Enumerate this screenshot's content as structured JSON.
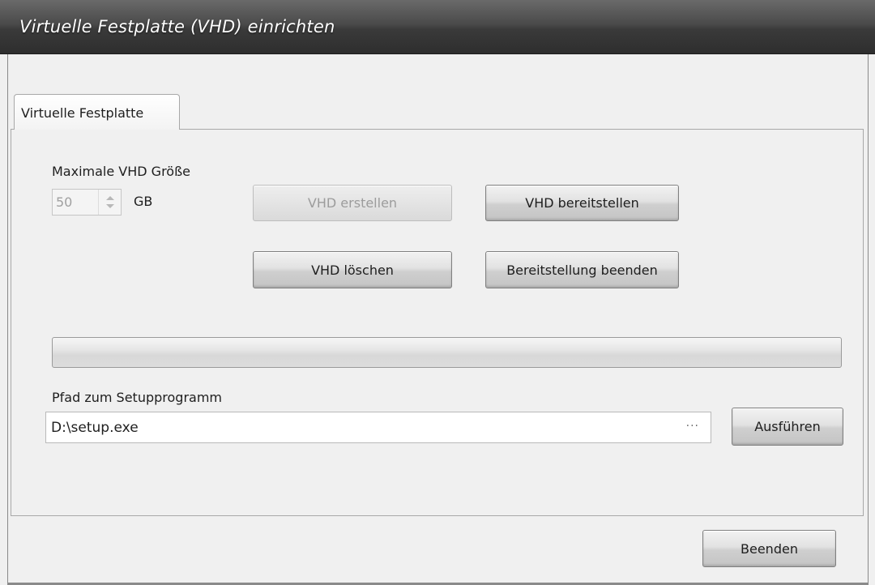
{
  "window": {
    "title": "Virtuelle Festplatte (VHD) einrichten"
  },
  "tabs": [
    {
      "label": "Virtuelle Festplatte",
      "selected": true
    }
  ],
  "vhd_size": {
    "label": "Maximale VHD Größe",
    "value": "50",
    "unit": "GB",
    "enabled": false
  },
  "buttons": {
    "create": {
      "label": "VHD erstellen",
      "enabled": false
    },
    "mount": {
      "label": "VHD bereitstellen",
      "enabled": true
    },
    "delete": {
      "label": "VHD löschen",
      "enabled": true
    },
    "unmount": {
      "label": "Bereitstellung beenden",
      "enabled": true
    },
    "run": {
      "label": "Ausführen",
      "enabled": true
    },
    "exit": {
      "label": "Beenden",
      "enabled": true
    }
  },
  "progress": {
    "value_percent": 0
  },
  "setup_path": {
    "label": "Pfad zum Setupprogramm",
    "value": "D:\\setup.exe",
    "browse_glyph": "..."
  },
  "icons": {
    "spin_up": "chevron-up-icon",
    "spin_down": "chevron-down-icon"
  }
}
